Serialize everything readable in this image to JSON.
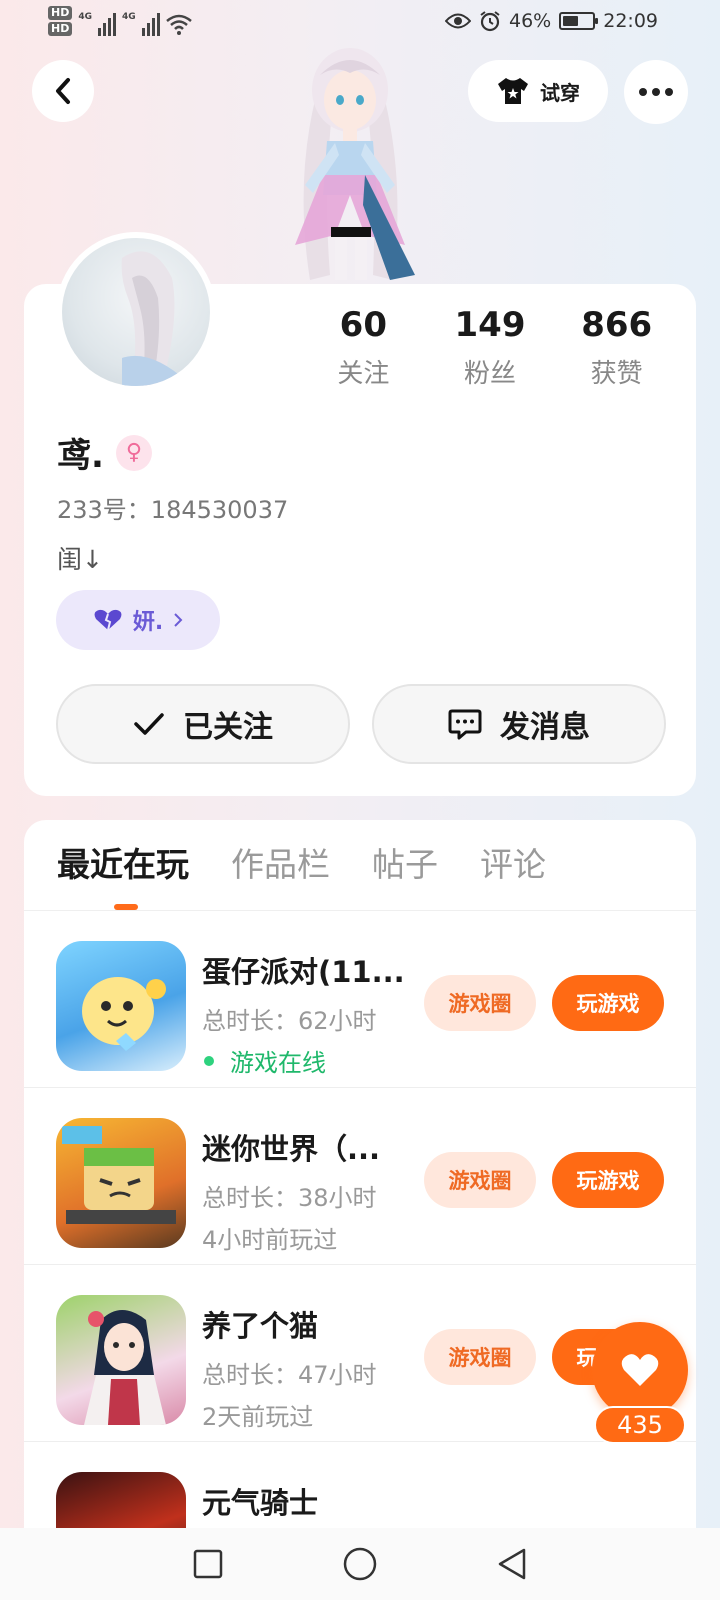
{
  "status_bar": {
    "hd1": "HD",
    "hd2": "HD",
    "network1": "4G",
    "network2": "4G",
    "battery": "46%",
    "time": "22:09"
  },
  "header": {
    "tryon_label": "试穿"
  },
  "profile": {
    "stats": [
      {
        "value": "60",
        "label": "关注"
      },
      {
        "value": "149",
        "label": "粉丝"
      },
      {
        "value": "866",
        "label": "获赞"
      }
    ],
    "username": "鸢.",
    "gender_symbol": "♀",
    "uid": "233号：184530037",
    "bio": "闺↓",
    "couple_tag": "妍.",
    "follow_button": "已关注",
    "message_button": "发消息"
  },
  "tabs": [
    {
      "label": "最近在玩",
      "active": true
    },
    {
      "label": "作品栏",
      "active": false
    },
    {
      "label": "帖子",
      "active": false
    },
    {
      "label": "评论",
      "active": false
    }
  ],
  "games": [
    {
      "name": "蛋仔派对(11...",
      "duration": "总时长：62小时",
      "status": "游戏在线",
      "online": true
    },
    {
      "name": "迷你世界（...",
      "duration": "总时长：38小时",
      "status": "4小时前玩过",
      "online": false
    },
    {
      "name": "养了个猫",
      "duration": "总时长：47小时",
      "status": "2天前玩过",
      "online": false
    },
    {
      "name": "元气骑士",
      "duration": "",
      "status": "",
      "online": false
    }
  ],
  "game_buttons": {
    "circle": "游戏圈",
    "play": "玩游戏"
  },
  "like": {
    "count": "435"
  },
  "colors": {
    "accent": "#ff6a14",
    "online": "#1fb86b",
    "couple": "#6b5bd6"
  }
}
